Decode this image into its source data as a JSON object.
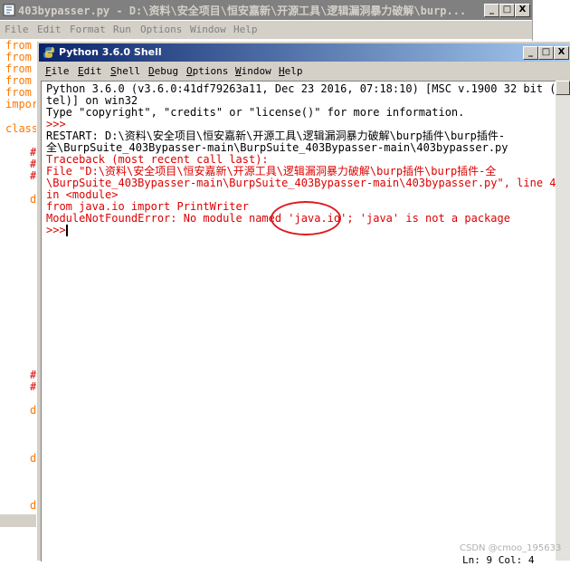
{
  "bg_window": {
    "title": "403bypasser.py - D:\\资料\\安全项目\\恒安嘉新\\开源工具\\逻辑漏洞暴力破解\\burp...",
    "controls": [
      "_",
      "□",
      "X"
    ],
    "menu": [
      "File",
      "Edit",
      "Format",
      "Run",
      "Options",
      "Window",
      "Help"
    ],
    "code_fragments": [
      "from",
      "from",
      "from",
      "from",
      "from",
      "impor",
      "class",
      "#",
      "#",
      "#",
      "d",
      "#",
      "#",
      "d",
      "d",
      "d"
    ]
  },
  "shell": {
    "title": "Python 3.6.0 Shell",
    "controls": [
      "_",
      "□",
      "X"
    ],
    "menu": [
      "File",
      "Edit",
      "Shell",
      "Debug",
      "Options",
      "Window",
      "Help"
    ],
    "lines": [
      {
        "text": "Python 3.6.0 (v3.6.0:41df79263a11, Dec 23 2016, 07:18:10) [MSC v.1900 32 bit (In",
        "color": "black"
      },
      {
        "text": "tel)] on win32",
        "color": "black"
      },
      {
        "text": "Type \"copyright\", \"credits\" or \"license()\" for more information.",
        "color": "black"
      },
      {
        "text": ">>> ",
        "color": "red"
      },
      {
        "text": " RESTART: D:\\资料\\安全项目\\恒安嘉新\\开源工具\\逻辑漏洞暴力破解\\burp插件\\burp插件-",
        "color": "black"
      },
      {
        "text": "全\\BurpSuite_403Bypasser-main\\BurpSuite_403Bypasser-main\\403bypasser.py",
        "color": "black"
      },
      {
        "text": "Traceback (most recent call last):",
        "color": "red"
      },
      {
        "text": "  File \"D:\\资料\\安全项目\\恒安嘉新\\开源工具\\逻辑漏洞暴力破解\\burp插件\\burp插件-全",
        "color": "red"
      },
      {
        "text": "\\BurpSuite_403Bypasser-main\\BurpSuite_403Bypasser-main\\403bypasser.py\", line 4,",
        "color": "red"
      },
      {
        "text": "in <module>",
        "color": "red"
      },
      {
        "text": "    from java.io import PrintWriter",
        "color": "red"
      },
      {
        "text": "ModuleNotFoundError: No module named 'java.io'; 'java' is not a package",
        "color": "red"
      },
      {
        "text": ">>> ",
        "color": "red"
      }
    ],
    "status": "Ln: 9 Col: 4"
  },
  "watermark": "CSDN @cmoo_195633",
  "colors": {
    "shell_title_start": "#0a246a",
    "shell_title_end": "#a6caf0",
    "error_red": "#dd0000",
    "annotation_circle": "#e0191e",
    "window_face": "#d4d0c8"
  }
}
